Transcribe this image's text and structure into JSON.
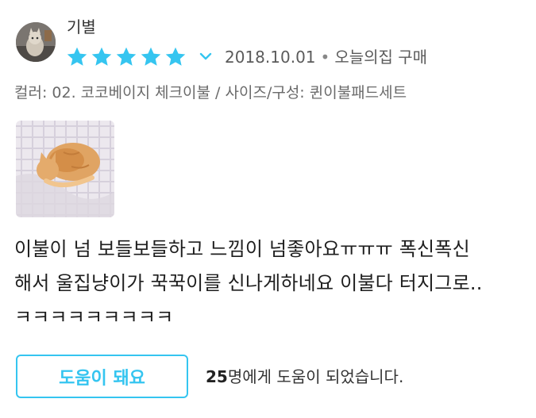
{
  "review": {
    "username": "기별",
    "rating": 5,
    "rating_max": 5,
    "date": "2018.10.01",
    "separator": "•",
    "purchase_source": "오늘의집 구매",
    "option_text": "컬러: 02. 코코베이지 체크이불 / 사이즈/구성: 퀸이불패드세트",
    "body_lines": [
      "이불이 넘 보들보들하고 느낌이 넘좋아요ㅠㅠㅠ 폭신폭신",
      "해서 울집냥이가 꾹꾹이를 신나게하네요 이불다 터지그로..",
      "ㅋㅋㅋㅋㅋㅋㅋㅋㅋ"
    ]
  },
  "actions": {
    "helpful_button_label": "도움이 돼요",
    "helpful_count": "25",
    "helpful_count_suffix": "명에게 도움이 되었습니다."
  },
  "icons": {
    "avatar": "cat-avatar",
    "star": "star-icon",
    "chevron": "chevron-down-icon",
    "photo": "cat-photo"
  },
  "colors": {
    "star": "#35c5f0",
    "accent": "#35c5f0",
    "text_primary": "#1e1e1e",
    "text_secondary": "#6a6a6a"
  }
}
